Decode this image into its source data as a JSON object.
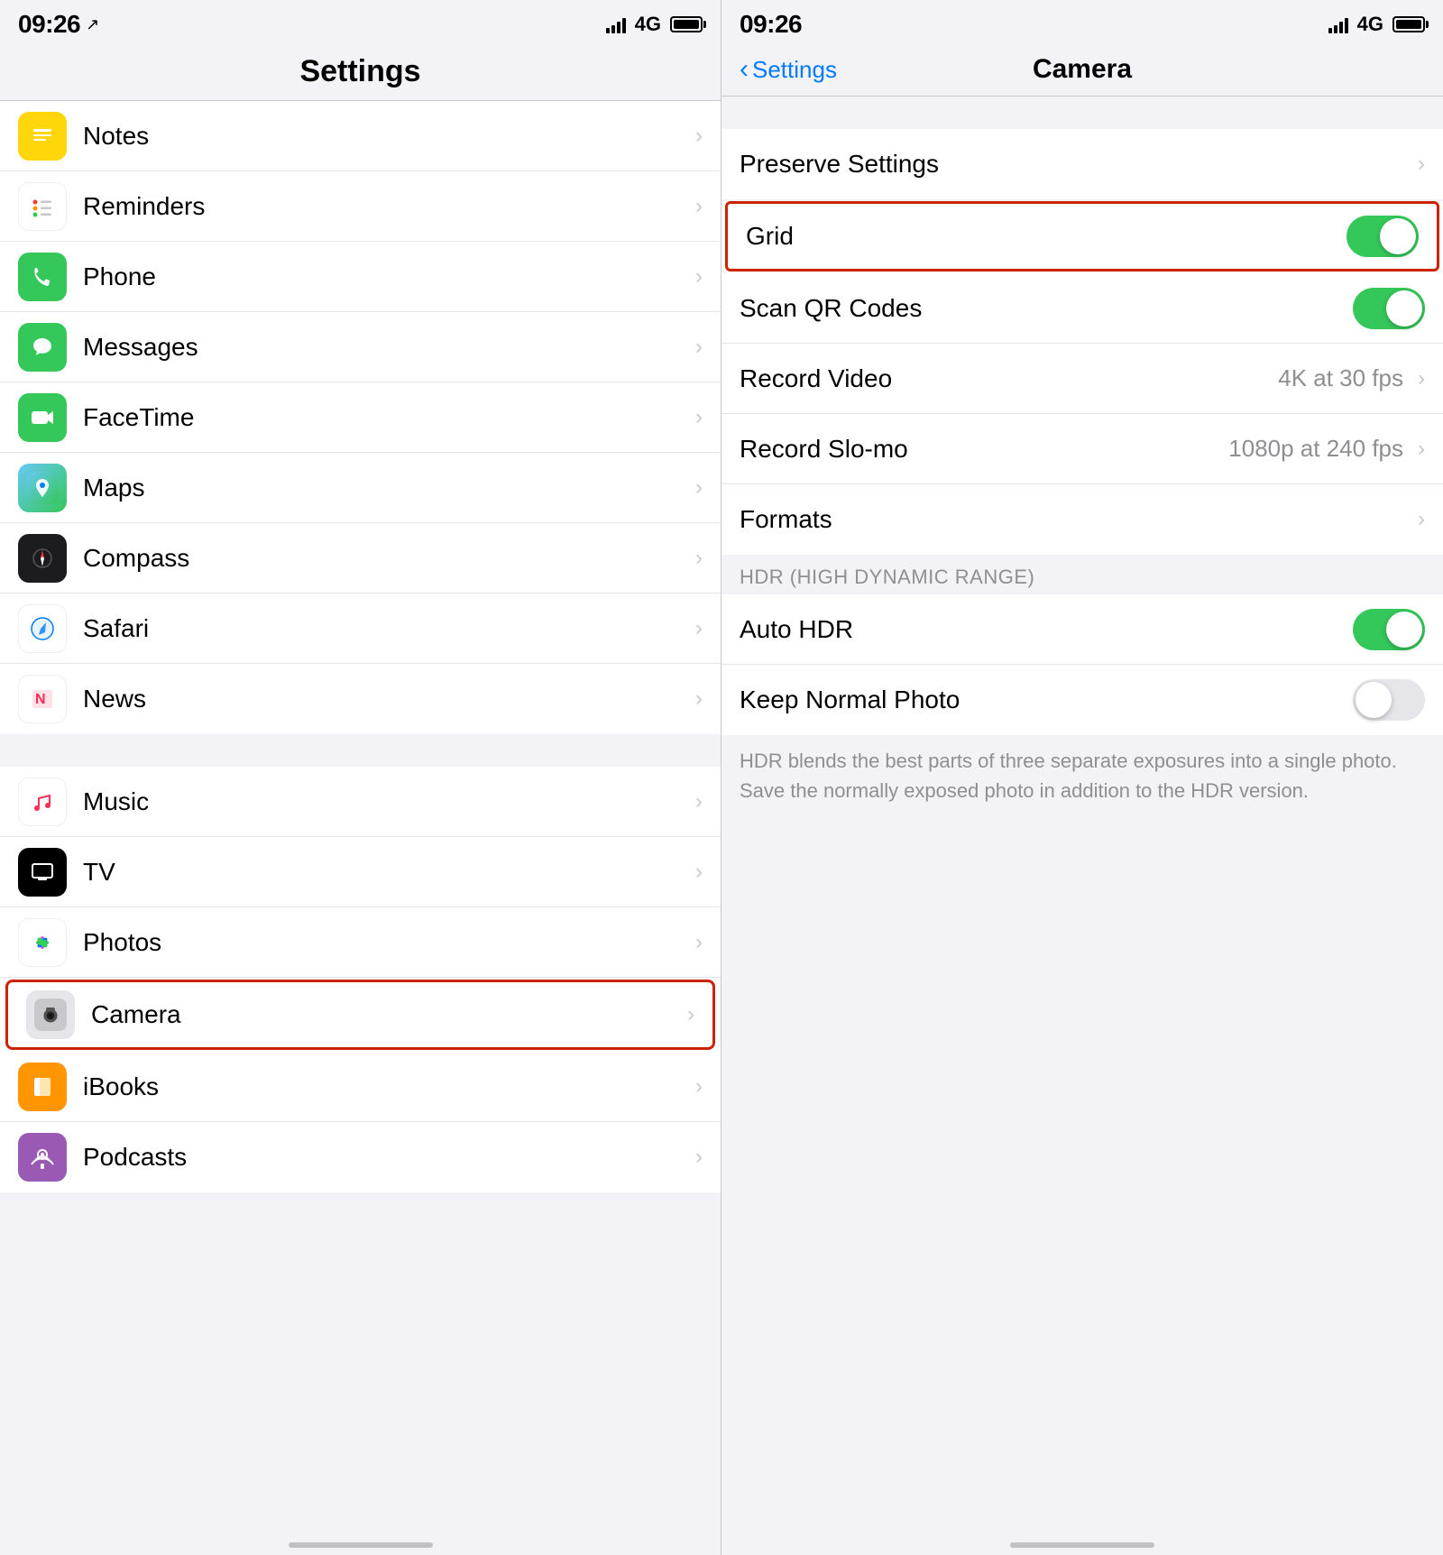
{
  "left_panel": {
    "status": {
      "time": "09:26",
      "location": true,
      "signal": "4G",
      "battery": "full"
    },
    "title": "Settings",
    "sections": [
      {
        "items": [
          {
            "id": "notes",
            "label": "Notes",
            "icon_bg": "notes",
            "chevron": true,
            "highlighted": false
          },
          {
            "id": "reminders",
            "label": "Reminders",
            "icon_bg": "reminders",
            "chevron": true,
            "highlighted": false
          },
          {
            "id": "phone",
            "label": "Phone",
            "icon_bg": "phone",
            "chevron": true,
            "highlighted": false
          },
          {
            "id": "messages",
            "label": "Messages",
            "icon_bg": "messages",
            "chevron": true,
            "highlighted": false
          },
          {
            "id": "facetime",
            "label": "FaceTime",
            "icon_bg": "facetime",
            "chevron": true,
            "highlighted": false
          },
          {
            "id": "maps",
            "label": "Maps",
            "icon_bg": "maps",
            "chevron": true,
            "highlighted": false
          },
          {
            "id": "compass",
            "label": "Compass",
            "icon_bg": "compass",
            "chevron": true,
            "highlighted": false
          },
          {
            "id": "safari",
            "label": "Safari",
            "icon_bg": "safari",
            "chevron": true,
            "highlighted": false
          },
          {
            "id": "news",
            "label": "News",
            "icon_bg": "news",
            "chevron": true,
            "highlighted": false
          }
        ]
      },
      {
        "items": [
          {
            "id": "music",
            "label": "Music",
            "icon_bg": "music",
            "chevron": true,
            "highlighted": false
          },
          {
            "id": "tv",
            "label": "TV",
            "icon_bg": "tv",
            "chevron": true,
            "highlighted": false
          },
          {
            "id": "photos",
            "label": "Photos",
            "icon_bg": "photos",
            "chevron": true,
            "highlighted": false
          },
          {
            "id": "camera",
            "label": "Camera",
            "icon_bg": "camera",
            "chevron": true,
            "highlighted": true
          },
          {
            "id": "ibooks",
            "label": "iBooks",
            "icon_bg": "ibooks",
            "chevron": true,
            "highlighted": false
          },
          {
            "id": "podcasts",
            "label": "Podcasts",
            "icon_bg": "podcasts",
            "chevron": true,
            "highlighted": false
          }
        ]
      }
    ]
  },
  "right_panel": {
    "status": {
      "time": "09:26",
      "signal": "4G",
      "battery": "full"
    },
    "nav": {
      "back_label": "Settings",
      "title": "Camera"
    },
    "sections": [
      {
        "items": [
          {
            "id": "preserve_settings",
            "label": "Preserve Settings",
            "type": "chevron",
            "value": "",
            "chevron": true,
            "toggle": null
          }
        ]
      },
      {
        "items": [
          {
            "id": "grid",
            "label": "Grid",
            "type": "toggle",
            "toggle_on": true,
            "highlighted": true
          },
          {
            "id": "scan_qr",
            "label": "Scan QR Codes",
            "type": "toggle",
            "toggle_on": true,
            "highlighted": false
          },
          {
            "id": "record_video",
            "label": "Record Video",
            "type": "chevron",
            "value": "4K at 30 fps",
            "chevron": true
          },
          {
            "id": "record_slomo",
            "label": "Record Slo-mo",
            "type": "chevron",
            "value": "1080p at 240 fps",
            "chevron": true
          },
          {
            "id": "formats",
            "label": "Formats",
            "type": "chevron",
            "value": "",
            "chevron": true
          }
        ]
      }
    ],
    "hdr_section": {
      "label": "HDR (HIGH DYNAMIC RANGE)",
      "items": [
        {
          "id": "auto_hdr",
          "label": "Auto HDR",
          "type": "toggle",
          "toggle_on": true
        },
        {
          "id": "keep_normal",
          "label": "Keep Normal Photo",
          "type": "toggle",
          "toggle_on": false
        }
      ],
      "description": "HDR blends the best parts of three separate exposures into a single photo. Save the normally exposed photo in addition to the HDR version."
    }
  },
  "colors": {
    "accent_blue": "#007aff",
    "green": "#34c759",
    "highlight_red": "#cc2200",
    "text_primary": "#000000",
    "text_secondary": "#8e8e93",
    "chevron": "#c7c7cc",
    "separator": "#e5e5ea",
    "background": "#f2f2f7",
    "white": "#ffffff"
  }
}
